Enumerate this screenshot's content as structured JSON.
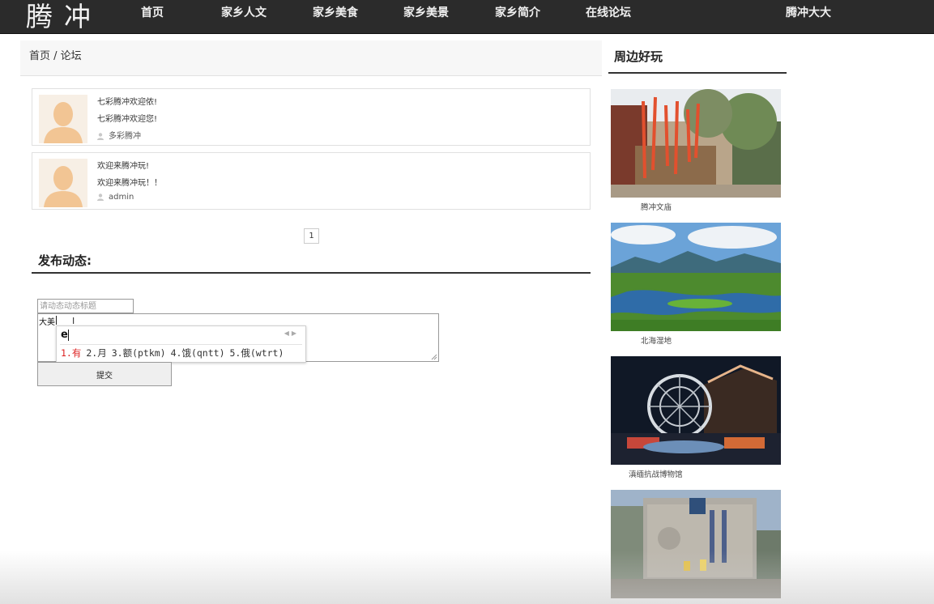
{
  "nav": {
    "logo": "腾冲",
    "items": [
      {
        "label": "首页"
      },
      {
        "label": "家乡人文"
      },
      {
        "label": "家乡美食"
      },
      {
        "label": "家乡美景"
      },
      {
        "label": "家乡简介"
      },
      {
        "label": "在线论坛"
      }
    ],
    "user": "腾冲大大"
  },
  "breadcrumb": {
    "home": "首页",
    "sep": " / ",
    "current": "论坛"
  },
  "posts": [
    {
      "title": "七彩腾冲欢迎侬!",
      "body": "七彩腾冲欢迎您!",
      "author": "多彩腾冲"
    },
    {
      "title": "欢迎来腾冲玩!",
      "body": "欢迎来腾冲玩！！",
      "author": "admin"
    }
  ],
  "pagination": {
    "current": "1"
  },
  "compose": {
    "heading": "发布动态:",
    "title_placeholder": "请动态动态标题",
    "content_value": "大美",
    "submit_label": "提交"
  },
  "ime": {
    "composition": "e",
    "candidates": [
      "1.有",
      "2.月",
      "3.额(ptkm)",
      "4.饿(qntt)",
      "5.俄(wtrt)"
    ]
  },
  "sidebar": {
    "title": "周边好玩",
    "cards": [
      {
        "caption": "腾冲文庙"
      },
      {
        "caption": "北海湿地"
      },
      {
        "caption": "滇缅抗战博物馆"
      },
      {
        "caption": ""
      }
    ]
  },
  "colors": {
    "nav_bg": "#2b2b2b",
    "rule": "#333333",
    "ime_selected": "#dd2222"
  }
}
